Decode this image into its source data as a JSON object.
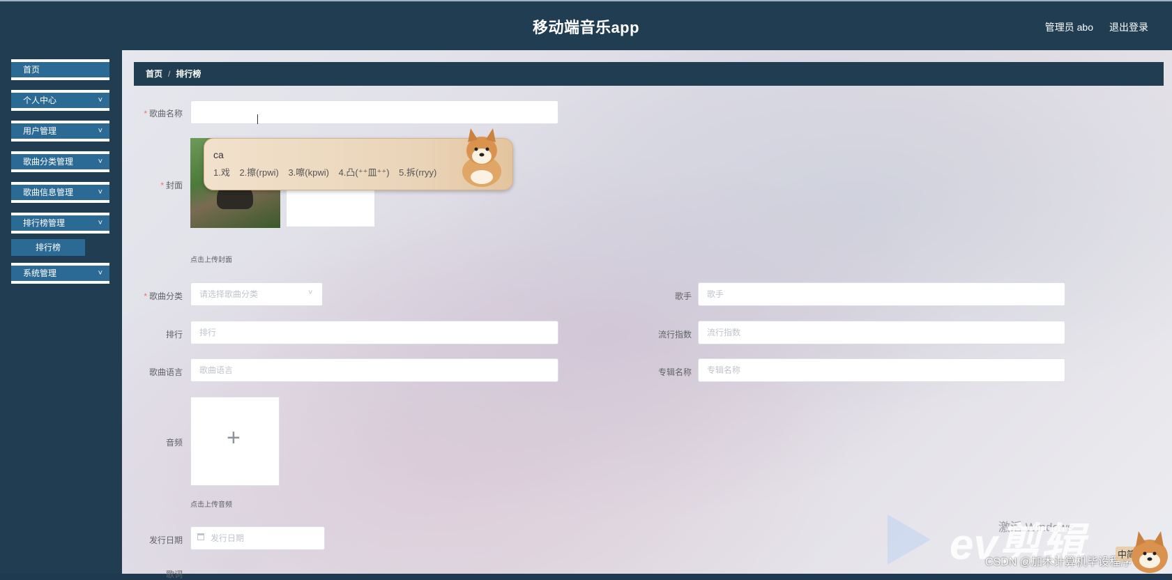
{
  "header": {
    "title": "移动端音乐app",
    "admin_label": "管理员 abo",
    "logout_label": "退出登录"
  },
  "sidebar": {
    "items": [
      {
        "label": "首页"
      },
      {
        "label": "个人中心"
      },
      {
        "label": "用户管理"
      },
      {
        "label": "歌曲分类管理"
      },
      {
        "label": "歌曲信息管理"
      },
      {
        "label": "排行榜管理"
      },
      {
        "label": "系统管理"
      }
    ],
    "sub_items": [
      {
        "label": "排行榜"
      }
    ],
    "chevron": "˅"
  },
  "breadcrumb": {
    "home": "首页",
    "separator": "/",
    "current": "排行榜"
  },
  "form": {
    "song_name": {
      "label": "歌曲名称",
      "value": ""
    },
    "cover": {
      "label": "封面",
      "hint": "点击上传封面"
    },
    "category": {
      "label": "歌曲分类",
      "placeholder": "请选择歌曲分类"
    },
    "singer": {
      "label": "歌手",
      "placeholder": "歌手"
    },
    "rank": {
      "label": "排行",
      "placeholder": "排行"
    },
    "popularity": {
      "label": "流行指数",
      "placeholder": "流行指数"
    },
    "language": {
      "label": "歌曲语言",
      "placeholder": "歌曲语言"
    },
    "album": {
      "label": "专辑名称",
      "placeholder": "专辑名称"
    },
    "audio": {
      "label": "音频",
      "hint": "点击上传音频",
      "plus": "+"
    },
    "release_date": {
      "label": "发行日期",
      "placeholder": "发行日期"
    },
    "lyrics": {
      "label": "歌词"
    },
    "required_mark": "*"
  },
  "ime": {
    "composition": "ca",
    "candidates": [
      "1.戏",
      "2.擦(rpwi)",
      "3.嚓(kpwi)",
      "4.凸(⁺⁺皿⁺⁺)",
      "5.拆(rryy)"
    ]
  },
  "watermark": {
    "activate_text": "激活 Windows",
    "ev_text": "ev剪辑",
    "csdn_text": "CSDN @加木计算机毕设程序",
    "ime_badge": "中简"
  }
}
